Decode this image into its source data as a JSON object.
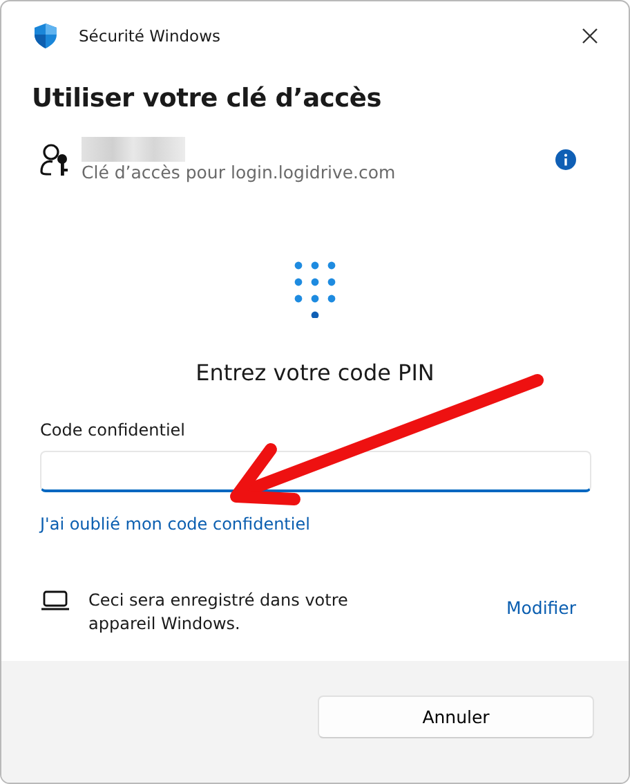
{
  "window": {
    "title": "Sécurité Windows"
  },
  "heading": "Utiliser votre clé d’accès",
  "account": {
    "subtitle": "Clé d’accès pour login.logidrive.com"
  },
  "prompt": "Entrez votre code PIN",
  "pin_field": {
    "label": "Code confidentiel"
  },
  "forgot_link": "J'ai oublié mon code confidentiel",
  "device": {
    "text": "Ceci sera enregistré dans votre appareil Windows.",
    "action": "Modifier"
  },
  "buttons": [
    "Annuler"
  ]
}
